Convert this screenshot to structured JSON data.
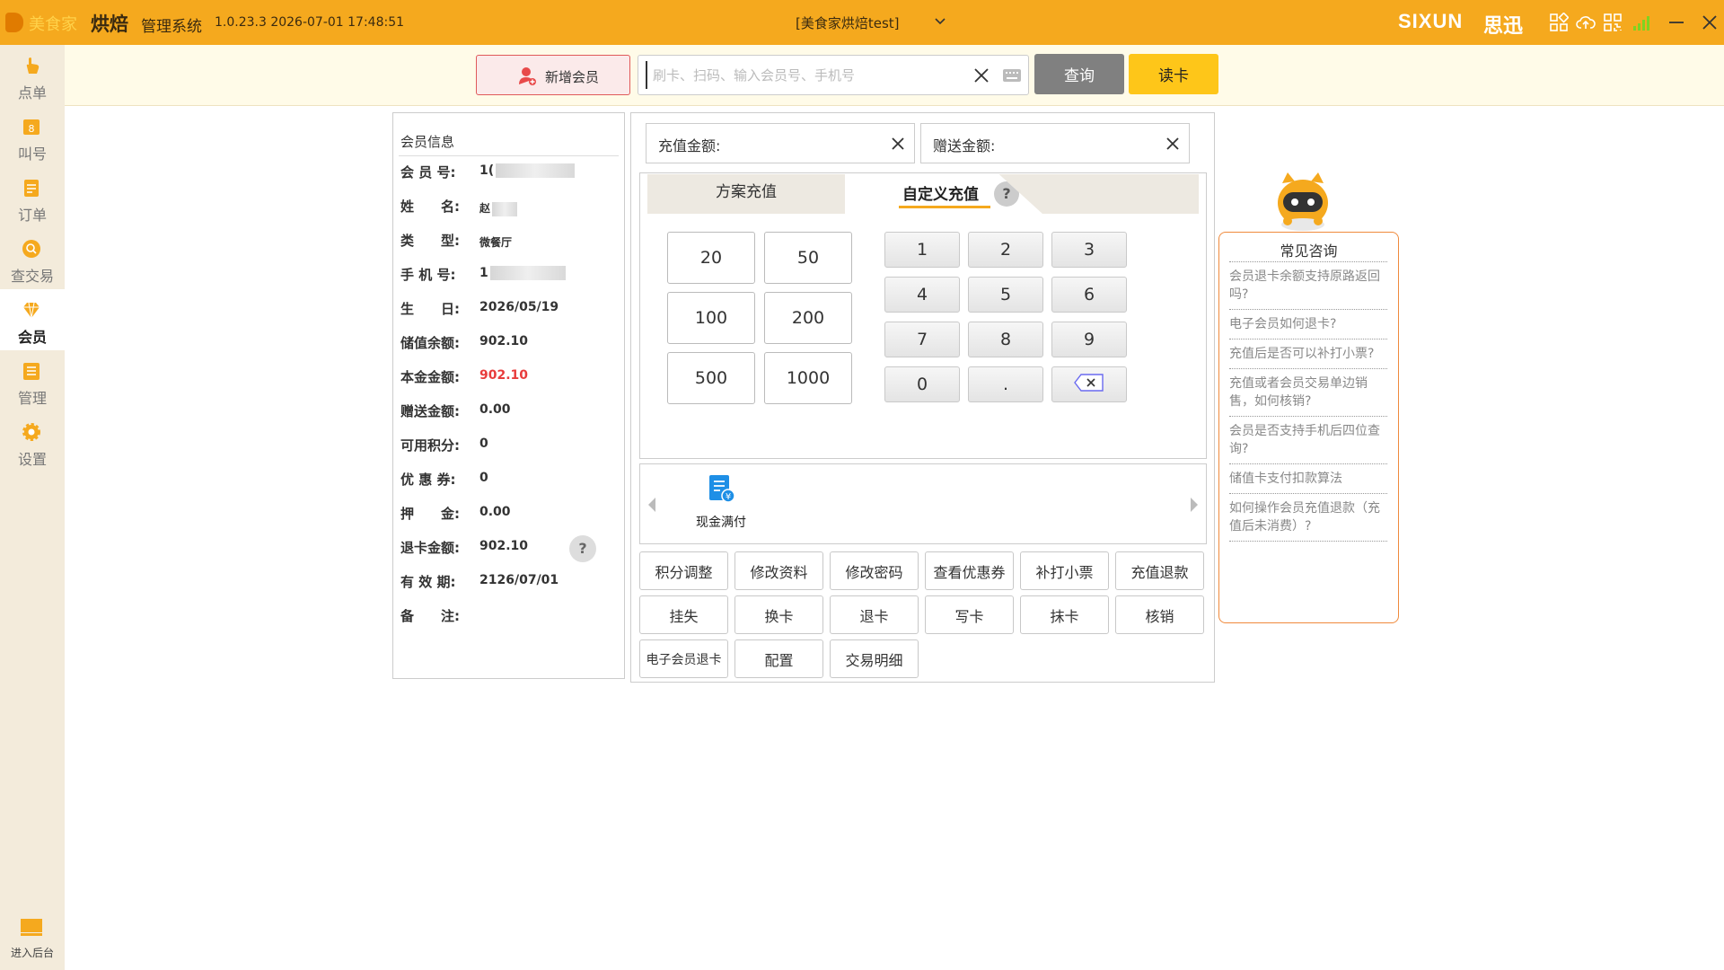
{
  "titlebar": {
    "brand": "美食家",
    "product": "烘焙",
    "system": "管理系统",
    "version": "1.0.23.3 2026-07-01 17:48:51",
    "store": "[美食家烘焙test]",
    "vendor_en": "SIXUN",
    "vendor_cn": "思迅",
    "accent_color": "#f5a91e"
  },
  "sidebar": {
    "items": [
      {
        "label": "点单",
        "icon": "hand-pointer-icon"
      },
      {
        "label": "叫号",
        "icon": "number-ticket-icon"
      },
      {
        "label": "订单",
        "icon": "clipboard-icon"
      },
      {
        "label": "查交易",
        "icon": "search-coin-icon"
      },
      {
        "label": "会员",
        "icon": "diamond-icon",
        "active": true
      },
      {
        "label": "管理",
        "icon": "list-icon"
      },
      {
        "label": "设置",
        "icon": "gear-icon"
      }
    ],
    "backend": "进入后台"
  },
  "search": {
    "add_member": "新增会员",
    "placeholder": "刷卡、扫码、输入会员号、手机号",
    "value": "",
    "query": "查询",
    "read_card": "读卡"
  },
  "member": {
    "title": "会员信息",
    "fields": [
      {
        "key": "会 员 号:",
        "value": "1("
      },
      {
        "key": "姓　　名:",
        "value": "赵"
      },
      {
        "key": "类　　型:",
        "value": "微餐厅"
      },
      {
        "key": "手 机 号:",
        "value": "1"
      },
      {
        "key": "生　　日:",
        "value": "2026/05/19"
      },
      {
        "key": "储值余额:",
        "value": "902.10"
      },
      {
        "key": "本金金额:",
        "value": "902.10"
      },
      {
        "key": "赠送金额:",
        "value": "0.00"
      },
      {
        "key": "可用积分:",
        "value": "0"
      },
      {
        "key": "优 惠 券:",
        "value": "0"
      },
      {
        "key": "押　　金:",
        "value": "0.00"
      },
      {
        "key": "退卡金额:",
        "value": "902.10"
      },
      {
        "key": "有 效 期:",
        "value": "2126/07/01"
      },
      {
        "key": "备　　注:",
        "value": ""
      }
    ],
    "help": "?"
  },
  "recharge": {
    "amount_label": "充值金额:",
    "bonus_label": "赠送金额:",
    "tabs": [
      "方案充值",
      "自定义充值"
    ],
    "active_tab": 1,
    "tab_help": "?",
    "presets": [
      "20",
      "50",
      "100",
      "200",
      "500",
      "1000"
    ],
    "keys": [
      "1",
      "2",
      "3",
      "4",
      "5",
      "6",
      "7",
      "8",
      "9",
      "0",
      "."
    ],
    "payment": {
      "label": "现金满付"
    },
    "actions": [
      "积分调整",
      "修改资料",
      "修改密码",
      "查看优惠券",
      "补打小票",
      "充值退款",
      "挂失",
      "换卡",
      "退卡",
      "写卡",
      "抹卡",
      "核销",
      "电子会员退卡",
      "配置",
      "交易明细"
    ]
  },
  "faq": {
    "title": "常见咨询",
    "items": [
      "会员退卡余额支持原路返回吗?",
      "电子会员如何退卡?",
      "充值后是否可以补打小票?",
      "充值或者会员交易单边销售，如何核销?",
      "会员是否支持手机后四位查询?",
      "储值卡支付扣款算法",
      "如何操作会员充值退款（充值后未消费）?"
    ]
  }
}
